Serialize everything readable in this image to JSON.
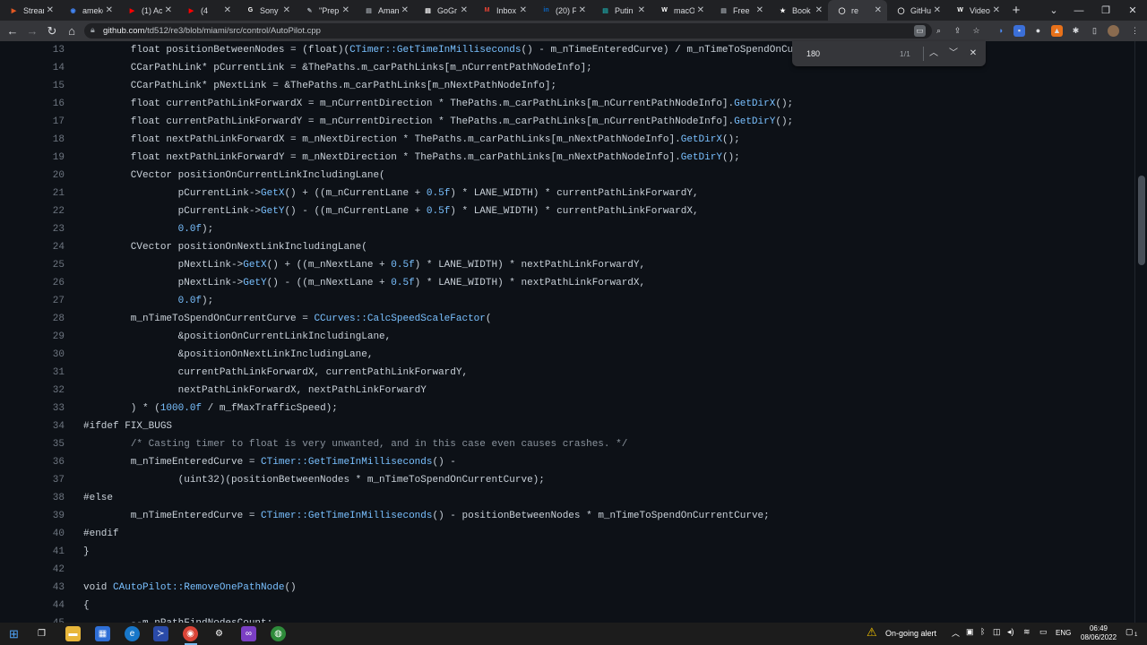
{
  "browser": {
    "tabs": [
      {
        "label": "Stream",
        "icon": "stream-icon",
        "color": "#e25822"
      },
      {
        "label": "ameko",
        "icon": "chrome-icon",
        "color": "#4285f4"
      },
      {
        "label": "(1) Ac",
        "icon": "youtube-icon",
        "color": "#ff0000"
      },
      {
        "label": "(4",
        "icon": "youtube-icon",
        "color": "#ff0000"
      },
      {
        "label": "Sony",
        "icon": "google-icon",
        "color": "#ffffff"
      },
      {
        "label": "\"Prep",
        "icon": "pen-icon",
        "color": "#9aa0a6"
      },
      {
        "label": "Aman",
        "icon": "page-icon",
        "color": "#9aa0a6"
      },
      {
        "label": "GoGr",
        "icon": "page-icon",
        "color": "#ffffff"
      },
      {
        "label": "Inbox",
        "icon": "gmail-icon",
        "color": "#ea4335"
      },
      {
        "label": "(20) F",
        "icon": "linkedin-icon",
        "color": "#0a66c2"
      },
      {
        "label": "Putin",
        "icon": "page-icon",
        "color": "#1da1a1"
      },
      {
        "label": "macO",
        "icon": "wikipedia-icon",
        "color": "#ffffff"
      },
      {
        "label": "Free",
        "icon": "page-icon",
        "color": "#9aa0a6"
      },
      {
        "label": "Book",
        "icon": "star-icon",
        "color": "#ffffff"
      },
      {
        "label": "re",
        "icon": "github-icon",
        "color": "#ffffff",
        "active": true
      },
      {
        "label": "GitHu",
        "icon": "github-icon",
        "color": "#ffffff"
      },
      {
        "label": "Video",
        "icon": "wikipedia-icon",
        "color": "#ffffff"
      }
    ],
    "new_tab": "+",
    "url_host": "github.com",
    "url_path": "/td512/re3/blob/miami/src/control/AutoPilot.cpp",
    "find": {
      "query": "180",
      "count": "1/1"
    }
  },
  "code": {
    "lines": [
      {
        "n": "13",
        "tokens": [
          [
            "p",
            "        float positionBetweenNodes = (float)("
          ],
          [
            "f",
            "CTimer::GetTimeInMilliseconds"
          ],
          [
            "p",
            "() - m_nTimeEnteredCurve) / m_nTimeToSpendOnCu"
          ]
        ]
      },
      {
        "n": "14",
        "tokens": [
          [
            "p",
            "        CCarPathLink* pCurrentLink = &ThePaths.m_carPathLinks[m_nCurrentPathNodeInfo];"
          ]
        ]
      },
      {
        "n": "15",
        "tokens": [
          [
            "p",
            "        CCarPathLink* pNextLink = &ThePaths.m_carPathLinks[m_nNextPathNodeInfo];"
          ]
        ]
      },
      {
        "n": "16",
        "tokens": [
          [
            "p",
            "        float currentPathLinkForwardX = m_nCurrentDirection * ThePaths.m_carPathLinks[m_nCurrentPathNodeInfo]."
          ],
          [
            "f",
            "GetDirX"
          ],
          [
            "p",
            "();"
          ]
        ]
      },
      {
        "n": "17",
        "tokens": [
          [
            "p",
            "        float currentPathLinkForwardY = m_nCurrentDirection * ThePaths.m_carPathLinks[m_nCurrentPathNodeInfo]."
          ],
          [
            "f",
            "GetDirY"
          ],
          [
            "p",
            "();"
          ]
        ]
      },
      {
        "n": "18",
        "tokens": [
          [
            "p",
            "        float nextPathLinkForwardX = m_nNextDirection * ThePaths.m_carPathLinks[m_nNextPathNodeInfo]."
          ],
          [
            "f",
            "GetDirX"
          ],
          [
            "p",
            "();"
          ]
        ]
      },
      {
        "n": "19",
        "tokens": [
          [
            "p",
            "        float nextPathLinkForwardY = m_nNextDirection * ThePaths.m_carPathLinks[m_nNextPathNodeInfo]."
          ],
          [
            "f",
            "GetDirY"
          ],
          [
            "p",
            "();"
          ]
        ]
      },
      {
        "n": "20",
        "tokens": [
          [
            "p",
            "        CVector positionOnCurrentLinkIncludingLane("
          ]
        ]
      },
      {
        "n": "21",
        "tokens": [
          [
            "p",
            "                pCurrentLink->"
          ],
          [
            "f",
            "GetX"
          ],
          [
            "p",
            "() + ((m_nCurrentLane + "
          ],
          [
            "n",
            "0.5f"
          ],
          [
            "p",
            ") * LANE_WIDTH) * currentPathLinkForwardY,"
          ]
        ]
      },
      {
        "n": "22",
        "tokens": [
          [
            "p",
            "                pCurrentLink->"
          ],
          [
            "f",
            "GetY"
          ],
          [
            "p",
            "() - ((m_nCurrentLane + "
          ],
          [
            "n",
            "0.5f"
          ],
          [
            "p",
            ") * LANE_WIDTH) * currentPathLinkForwardX,"
          ]
        ]
      },
      {
        "n": "23",
        "tokens": [
          [
            "p",
            "                "
          ],
          [
            "n",
            "0.0f"
          ],
          [
            "p",
            ");"
          ]
        ]
      },
      {
        "n": "24",
        "tokens": [
          [
            "p",
            "        CVector positionOnNextLinkIncludingLane("
          ]
        ]
      },
      {
        "n": "25",
        "tokens": [
          [
            "p",
            "                pNextLink->"
          ],
          [
            "f",
            "GetX"
          ],
          [
            "p",
            "() + ((m_nNextLane + "
          ],
          [
            "n",
            "0.5f"
          ],
          [
            "p",
            ") * LANE_WIDTH) * nextPathLinkForwardY,"
          ]
        ]
      },
      {
        "n": "26",
        "tokens": [
          [
            "p",
            "                pNextLink->"
          ],
          [
            "f",
            "GetY"
          ],
          [
            "p",
            "() - ((m_nNextLane + "
          ],
          [
            "n",
            "0.5f"
          ],
          [
            "p",
            ") * LANE_WIDTH) * nextPathLinkForwardX,"
          ]
        ]
      },
      {
        "n": "27",
        "tokens": [
          [
            "p",
            "                "
          ],
          [
            "n",
            "0.0f"
          ],
          [
            "p",
            ");"
          ]
        ]
      },
      {
        "n": "28",
        "tokens": [
          [
            "p",
            "        m_nTimeToSpendOnCurrentCurve = "
          ],
          [
            "f",
            "CCurves::CalcSpeedScaleFactor"
          ],
          [
            "p",
            "("
          ]
        ]
      },
      {
        "n": "29",
        "tokens": [
          [
            "p",
            "                &positionOnCurrentLinkIncludingLane,"
          ]
        ]
      },
      {
        "n": "30",
        "tokens": [
          [
            "p",
            "                &positionOnNextLinkIncludingLane,"
          ]
        ]
      },
      {
        "n": "31",
        "tokens": [
          [
            "p",
            "                currentPathLinkForwardX, currentPathLinkForwardY,"
          ]
        ]
      },
      {
        "n": "32",
        "tokens": [
          [
            "p",
            "                nextPathLinkForwardX, nextPathLinkForwardY"
          ]
        ]
      },
      {
        "n": "33",
        "tokens": [
          [
            "p",
            "        ) * ("
          ],
          [
            "n",
            "1000.0f"
          ],
          [
            "p",
            " / m_fMaxTrafficSpeed);"
          ]
        ]
      },
      {
        "n": "34",
        "tokens": [
          [
            "p",
            "#ifdef FIX_BUGS"
          ]
        ]
      },
      {
        "n": "35",
        "tokens": [
          [
            "p",
            "        "
          ],
          [
            "c",
            "/* Casting timer to float is very unwanted, and in this case even causes crashes. */"
          ]
        ]
      },
      {
        "n": "36",
        "tokens": [
          [
            "p",
            "        m_nTimeEnteredCurve = "
          ],
          [
            "f",
            "CTimer::GetTimeInMilliseconds"
          ],
          [
            "p",
            "() -"
          ]
        ]
      },
      {
        "n": "37",
        "tokens": [
          [
            "p",
            "                (uint32)(positionBetweenNodes * m_nTimeToSpendOnCurrentCurve);"
          ]
        ]
      },
      {
        "n": "38",
        "tokens": [
          [
            "p",
            "#else"
          ]
        ]
      },
      {
        "n": "39",
        "tokens": [
          [
            "p",
            "        m_nTimeEnteredCurve = "
          ],
          [
            "f",
            "CTimer::GetTimeInMilliseconds"
          ],
          [
            "p",
            "() - positionBetweenNodes * m_nTimeToSpendOnCurrentCurve;"
          ]
        ]
      },
      {
        "n": "40",
        "tokens": [
          [
            "p",
            "#endif"
          ]
        ]
      },
      {
        "n": "41",
        "tokens": [
          [
            "p",
            "}"
          ]
        ]
      },
      {
        "n": "42",
        "tokens": [
          [
            "p",
            ""
          ]
        ]
      },
      {
        "n": "43",
        "tokens": [
          [
            "p",
            "void "
          ],
          [
            "f",
            "CAutoPilot::RemoveOnePathNode"
          ],
          [
            "p",
            "()"
          ]
        ]
      },
      {
        "n": "44",
        "tokens": [
          [
            "p",
            "{"
          ]
        ]
      },
      {
        "n": "45",
        "tokens": [
          [
            "p",
            "        --m_nPathFindNodesCount;"
          ]
        ]
      }
    ]
  },
  "taskbar": {
    "alert": "On-going alert",
    "lang": "ENG",
    "time": "06:49",
    "date": "08/06/2022",
    "notif_count": "1"
  },
  "colors": {
    "page_bg": "#0d1117",
    "code_text": "#c9d1d9",
    "function": "#79c0ff",
    "comment": "#8b949e",
    "line_number": "#6e7681"
  }
}
